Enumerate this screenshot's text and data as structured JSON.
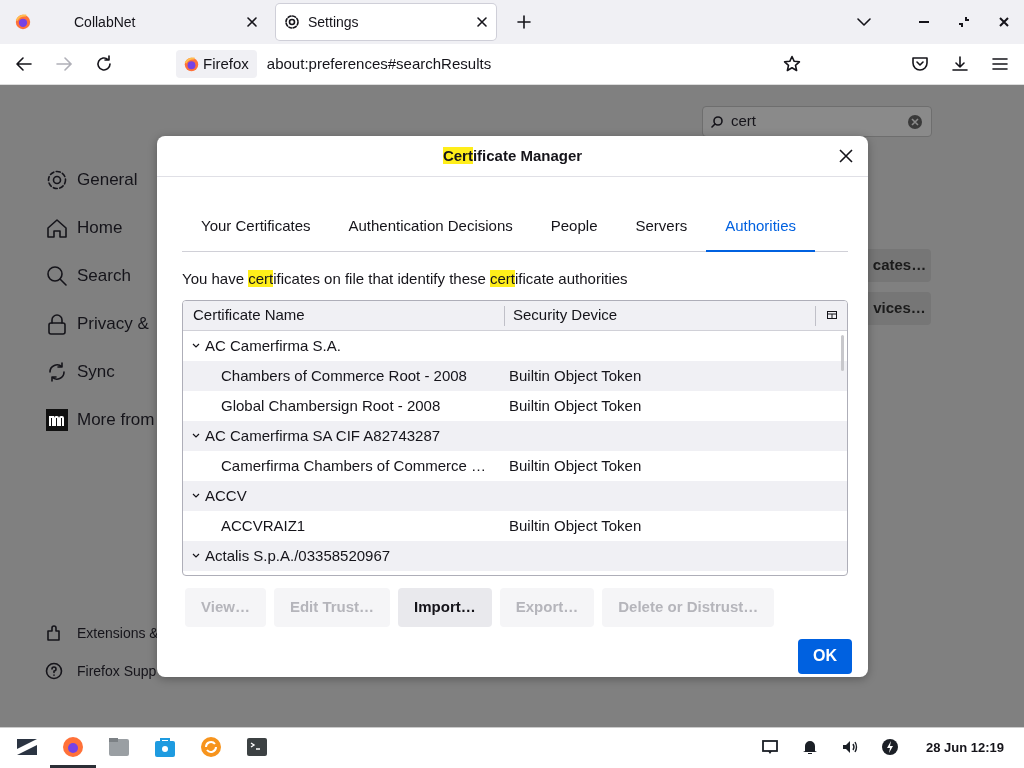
{
  "browser": {
    "tabs": [
      {
        "label": "CollabNet",
        "selected": false
      },
      {
        "label": "Settings",
        "selected": true
      }
    ],
    "identity": "Firefox",
    "url": "about:preferences#searchResults"
  },
  "settings": {
    "search": {
      "value": "cert"
    },
    "sidebar": {
      "items": [
        {
          "label": "General"
        },
        {
          "label": "Home"
        },
        {
          "label": "Search"
        },
        {
          "label": "Privacy &"
        },
        {
          "label": "Sync"
        },
        {
          "label": "More from"
        }
      ],
      "footer_items": [
        {
          "label": "Extensions &"
        },
        {
          "label": "Firefox Supp"
        }
      ]
    },
    "buttons": [
      "cates…",
      "vices…"
    ]
  },
  "dialog": {
    "title": "Certificate Manager",
    "tabs": [
      {
        "label": "Your Certificates",
        "selected": false
      },
      {
        "label": "Authentication Decisions",
        "selected": false
      },
      {
        "label": "People",
        "selected": false
      },
      {
        "label": "Servers",
        "selected": false
      },
      {
        "label": "Authorities",
        "selected": true
      }
    ],
    "description": "You have certificates on file that identify these certificate authorities",
    "table": {
      "columns": [
        "Certificate Name",
        "Security Device"
      ],
      "rows": [
        {
          "name": "AC Camerfirma S.A.",
          "expanded": true,
          "children": [
            {
              "name": "Chambers of Commerce Root - 2008",
              "device": "Builtin Object Token"
            },
            {
              "name": "Global Chambersign Root - 2008",
              "device": "Builtin Object Token"
            }
          ]
        },
        {
          "name": "AC Camerfirma SA CIF A82743287",
          "expanded": true,
          "children": [
            {
              "name": "Camerfirma Chambers of Commerce …",
              "device": "Builtin Object Token"
            }
          ]
        },
        {
          "name": "ACCV",
          "expanded": true,
          "children": [
            {
              "name": "ACCVRAIZ1",
              "device": "Builtin Object Token"
            }
          ]
        },
        {
          "name": "Actalis S.p.A./03358520967",
          "expanded": true
        }
      ]
    },
    "actions": [
      {
        "label": "View…",
        "disabled": true
      },
      {
        "label": "Edit Trust…",
        "disabled": true
      },
      {
        "label": "Import…",
        "disabled": false
      },
      {
        "label": "Export…",
        "disabled": true
      },
      {
        "label": "Delete or Distrust…",
        "disabled": true
      }
    ],
    "ok": "OK"
  },
  "taskbar": {
    "apps": [
      {
        "active": true
      },
      {
        "active": false
      },
      {
        "active": false
      },
      {
        "active": false
      },
      {
        "active": false
      }
    ],
    "clock": "28 Jun 12:19"
  }
}
